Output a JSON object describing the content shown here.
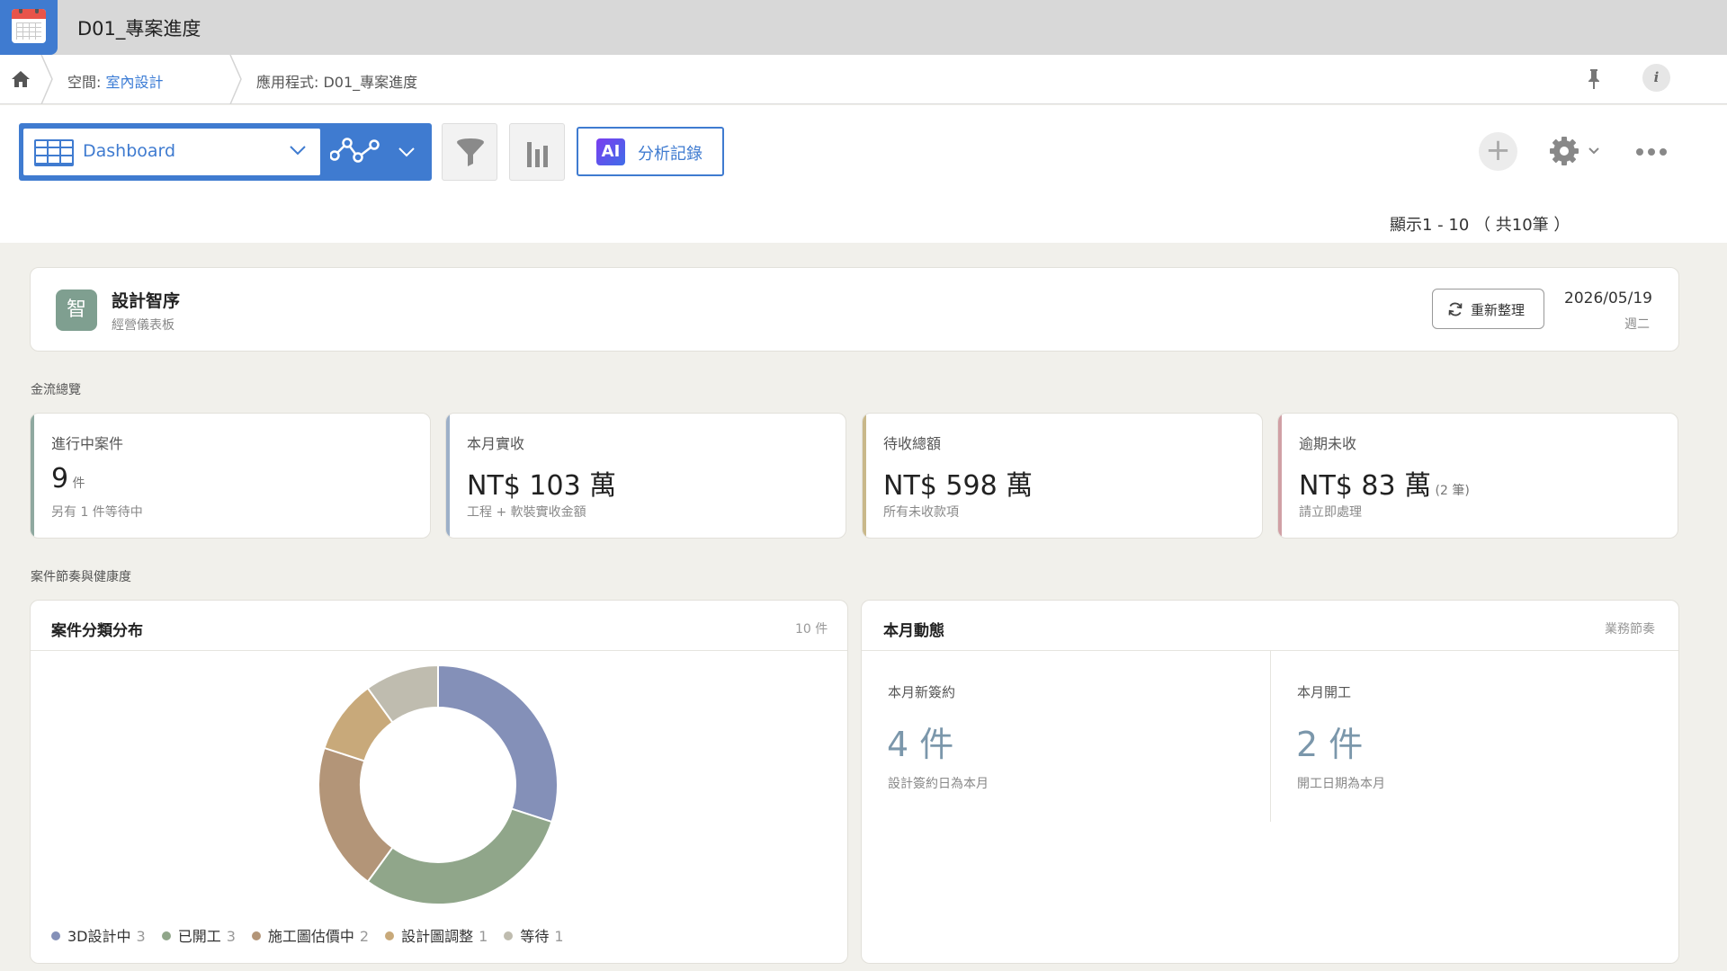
{
  "titlebar": {
    "title": "D01_專案進度"
  },
  "breadcrumb": {
    "space_prefix": "空間: ",
    "space_name": "室內設計",
    "app": "應用程式: D01_專案進度"
  },
  "toolbar": {
    "view_label": "Dashboard",
    "ai_badge": "AI",
    "ai_label": "分析記錄",
    "add_label": "+",
    "paging": "顯示1 - 10 （ 共10筆 ）"
  },
  "header": {
    "badge": "智",
    "name": "設計智序",
    "subtitle": "經營儀表板",
    "refresh_label": "重新整理",
    "date": "2026/05/19",
    "weekday": "週二"
  },
  "sections": {
    "cashflow": "金流總覽",
    "rhythm": "案件節奏與健康度"
  },
  "kpis": [
    {
      "title": "進行中案件",
      "value": "9",
      "unit": " 件",
      "sub": "另有 1 件等待中",
      "accent": "#8fa9a0"
    },
    {
      "title": "本月實收",
      "value": "NT$ 103 萬",
      "unit": "",
      "sub": "工程 + 軟裝實收金額",
      "accent": "#9db0c8"
    },
    {
      "title": "待收總額",
      "value": "NT$ 598 萬",
      "unit": "",
      "sub": "所有未收款項",
      "accent": "#c9b88a"
    },
    {
      "title": "逾期未收",
      "value": "NT$ 83 萬",
      "unit": " (2 筆)",
      "sub": "請立即處理",
      "accent": "#d0a0a5"
    }
  ],
  "distribution": {
    "title": "案件分類分布",
    "count": "10 件"
  },
  "chart_data": {
    "type": "pie",
    "categories": [
      "3D設計中",
      "已開工",
      "施工圖估價中",
      "設計圖調整",
      "等待"
    ],
    "values": [
      3,
      3,
      2,
      1,
      1
    ],
    "colors": [
      "#8490b8",
      "#90a68a",
      "#b39578",
      "#c8a97a",
      "#bfbcaf"
    ],
    "donut": true
  },
  "monthly": {
    "title": "本月動態",
    "meta": "業務節奏",
    "new_contracts": {
      "title": "本月新簽約",
      "value": "4 件",
      "sub": "設計簽約日為本月"
    },
    "started": {
      "title": "本月開工",
      "value": "2 件",
      "sub": "開工日期為本月"
    }
  }
}
